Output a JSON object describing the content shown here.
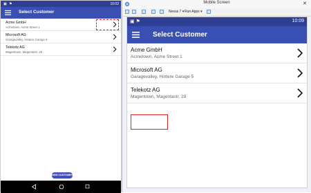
{
  "left_phone": {
    "status": {
      "left_icons": "▣ ⚑",
      "time": "10:02"
    },
    "app_title": "Select Customer",
    "customers": [
      {
        "name": "Acme GmbH",
        "address": "Acmetown, Acme Street 1"
      },
      {
        "name": "Microsoft AG",
        "address": "Garagevalley, Hintere Garage 5"
      },
      {
        "name": "Telekotz AG",
        "address": "Magentown, Magentastr. 29"
      }
    ],
    "new_customer_button": "NEW CUSTOMER"
  },
  "mobile_screen_window": {
    "window_title": "Mobile Screen",
    "toolbar": {
      "device": "Nexus 7 ▾",
      "run_apps": "Run Apps ▾"
    },
    "status": {
      "left_icons": "▣ ⚑",
      "time": "10:09"
    },
    "app_title": "Select Customer",
    "customers": [
      {
        "name": "Acme GmbH",
        "address": "Acmetown, Acme Street 1"
      },
      {
        "name": "Microsoft AG",
        "address": "Garagevalley, Hintere Garage 5"
      },
      {
        "name": "Telekotz AG",
        "address": "Magentown, Magentastr. 29"
      }
    ]
  },
  "colors": {
    "status_bar": "#2e3e92",
    "app_bar": "#3a4fb2",
    "button": "#3f4fbf",
    "selection_outline": "#e02020"
  },
  "icons": {
    "menu": "hamburger-menu-icon",
    "chevron": "chevron-right-icon",
    "back": "back-triangle-icon",
    "home": "home-circle-icon",
    "recents": "recents-square-icon",
    "close": "close-icon"
  }
}
